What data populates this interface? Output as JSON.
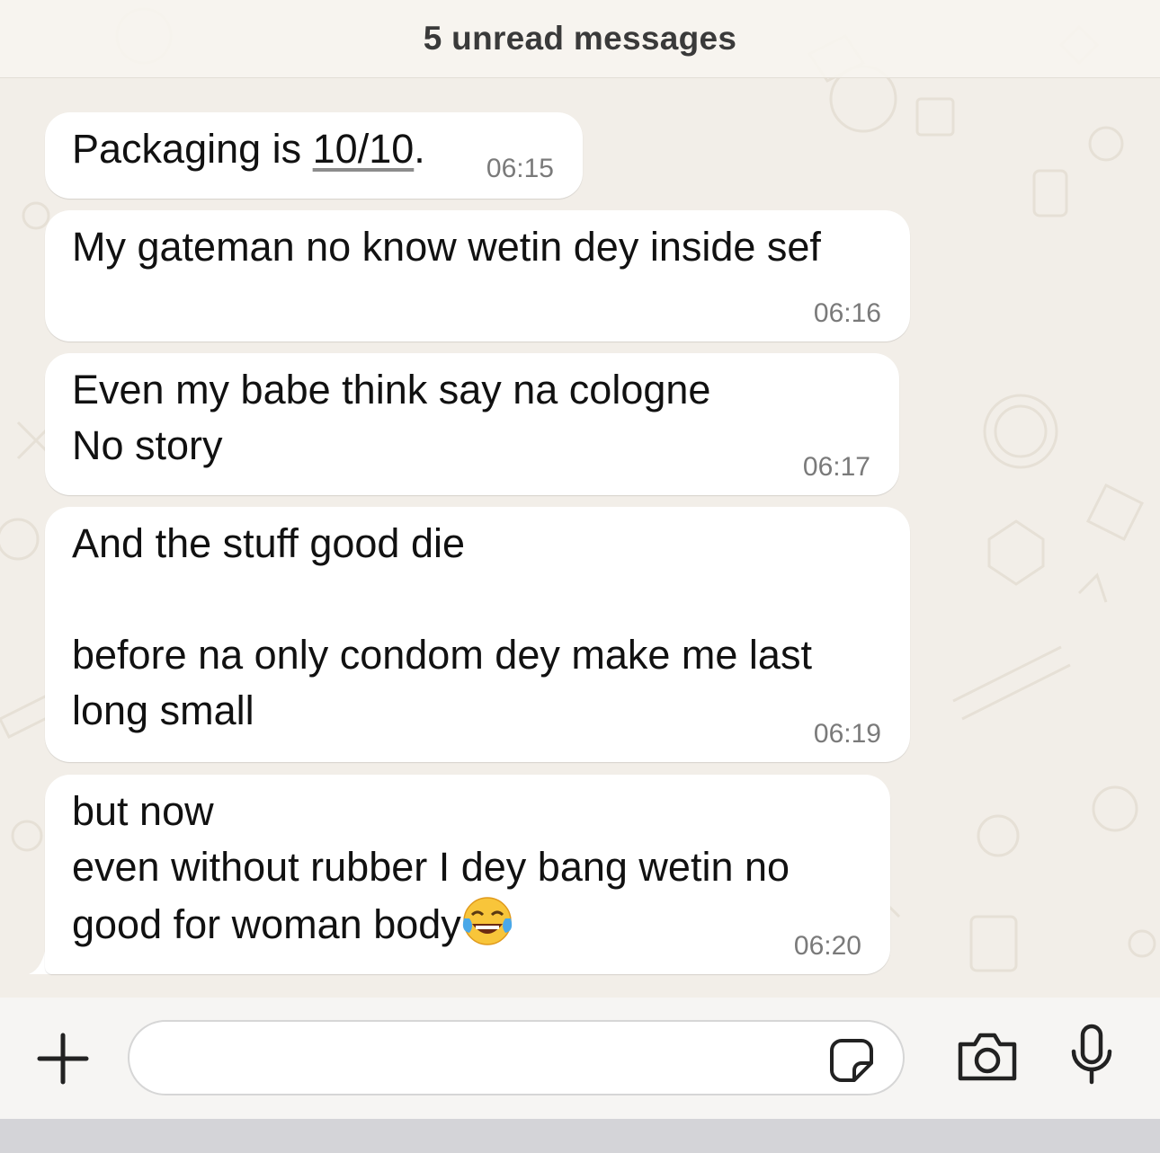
{
  "chat": {
    "unread_banner": "5 unread messages",
    "messages": [
      {
        "prefix": "Packaging is ",
        "underlined": "10/10",
        "suffix": ".",
        "time": "06:15"
      },
      {
        "text": "My gateman no know wetin dey inside sef",
        "time": "06:16"
      },
      {
        "text": "Even my babe think say na cologne\nNo story",
        "time": "06:17"
      },
      {
        "text": "And the stuff good die\n\nbefore na only condom dey make me last\nlong small",
        "time": "06:19"
      },
      {
        "text": "but now\neven without rubber I dey bang wetin no\ngood for woman body",
        "emoji": "face-with-tears-of-joy-emoji",
        "time": "06:20"
      }
    ]
  },
  "composer": {
    "message_value": "",
    "icons": {
      "attach": "plus-icon",
      "sticker": "sticker-icon",
      "camera": "camera-icon",
      "mic": "microphone-icon"
    }
  },
  "colors": {
    "wallpaper": "#f2eee8",
    "bubble": "#ffffff",
    "timestamp": "#7a7a7a"
  }
}
